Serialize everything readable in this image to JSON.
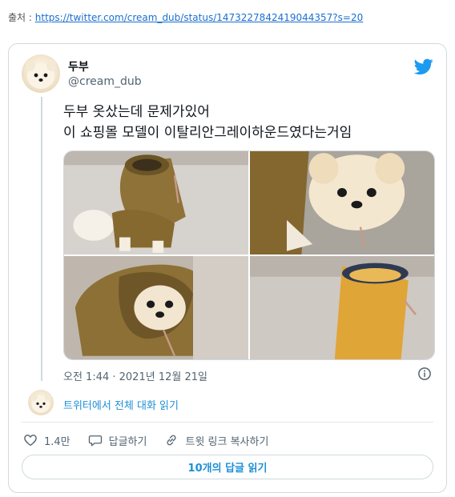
{
  "source": {
    "label": "출처 : ",
    "url": "https://twitter.com/cream_dub/status/1473227842419044357?s=20"
  },
  "tweet": {
    "display_name": "두부",
    "handle": "@cream_dub",
    "text_lines": [
      "두부 옷샀는데 문제가있어",
      "이 쇼핑몰 모델이 이탈리안그레이하운드였다는거임"
    ],
    "timestamp": "오전 1:44 · 2021년 12월 21일",
    "read_conversation": "트위터에서 전체 대화 읽기",
    "like_count": "1.4만",
    "reply_label": "답글하기",
    "copy_link_label": "트윗 링크 복사하기",
    "read_replies": "10개의 답글 읽기"
  },
  "icons": {
    "logo": "twitter-bird-icon",
    "info": "info-icon",
    "like": "heart-icon",
    "reply": "speech-bubble-icon",
    "copy_link": "link-icon"
  },
  "colors": {
    "accent": "#1d9bf0",
    "link": "#1b6fd0",
    "muted": "#536471",
    "border": "#cfd9de"
  }
}
